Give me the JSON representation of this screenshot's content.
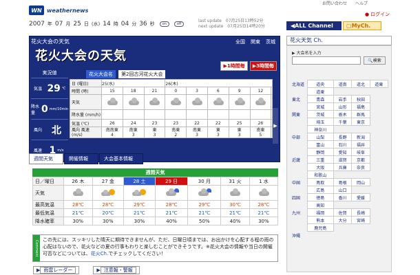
{
  "header": {
    "brand": "weathernews",
    "links": [
      "お問い合わせ",
      "ヘルプ"
    ],
    "login": "ログイン"
  },
  "datebar": {
    "year": "2007",
    "month": "07",
    "day": "25",
    "weekday": "水",
    "hour": "14",
    "minute": "04",
    "second": "36",
    "toggles": [
      "on",
      "off"
    ],
    "last_update_label": "last update",
    "last_update_value": "07月25日13時52分",
    "next_update_label": "next update",
    "next_update_value": "07月25日14時20分"
  },
  "main": {
    "panel_title": "花火大会の天気",
    "region_tabs": [
      "全国",
      "関東",
      "茨城"
    ],
    "big_title": "花火大会の天気",
    "radar_buttons": [
      "1時間毎",
      "3時間毎"
    ],
    "current": {
      "heading": "実況値",
      "rows": [
        {
          "label": "気温",
          "value": "29",
          "unit": "℃"
        },
        {
          "label": "降水量",
          "value": "0",
          "unit": "mm/10min"
        },
        {
          "label": "風向",
          "value": "北",
          "unit": ""
        },
        {
          "label": "風速",
          "value": "1",
          "unit": "m/s"
        }
      ]
    },
    "event_tag": "花火大会名",
    "event_name": "第2回古河花火大会",
    "hourly": {
      "day_label": "日 (曜日)",
      "days": [
        {
          "label": "25(水)",
          "span": 3
        },
        {
          "label": "26(木)",
          "span": 6
        }
      ],
      "time_label": "時間 (時)",
      "times": [
        "15",
        "18",
        "21",
        "0",
        "3",
        "6",
        "9",
        "12",
        ""
      ],
      "weather_label": "天気",
      "precip_label": "降水量 (mm/h)",
      "temp_label": "気温 (℃)",
      "temps": [
        "26",
        "24",
        "23",
        "23",
        "22",
        "22",
        "25",
        "26",
        ""
      ],
      "wind_label": "風向 風速 (m/s)",
      "winds": [
        {
          "dir": "南南東",
          "speed": "4"
        },
        {
          "dir": "南東",
          "speed": "3"
        },
        {
          "dir": "東",
          "speed": "3"
        },
        {
          "dir": "南東",
          "speed": "2"
        },
        {
          "dir": "南東",
          "speed": "3"
        },
        {
          "dir": "東",
          "speed": "3"
        },
        {
          "dir": "東",
          "speed": "3"
        },
        {
          "dir": "南東",
          "speed": "5"
        },
        {
          "dir": "",
          "speed": ""
        }
      ]
    },
    "scroll_arrow": "▶"
  },
  "tabs": [
    "週間天気",
    "開催情報",
    "大会基本情報"
  ],
  "weekly": {
    "heading": "週間天気",
    "day_label": "日／曜日",
    "days": [
      {
        "label": "26 木",
        "kind": "normal"
      },
      {
        "label": "27 金",
        "kind": "normal"
      },
      {
        "label": "28 土",
        "kind": "sat"
      },
      {
        "label": "29 日",
        "kind": "sun"
      },
      {
        "label": "30 月",
        "kind": "normal"
      },
      {
        "label": "31 火",
        "kind": "normal"
      },
      {
        "label": "1 水",
        "kind": "normal"
      }
    ],
    "icons": [
      "cloud",
      "sun-cloud",
      "sun-cloud",
      "cloud-rain",
      "cloud-rain",
      "cloud",
      "cloud"
    ],
    "weather_label": "天気",
    "high_label": "最高気温",
    "highs": [
      "28℃",
      "28℃",
      "29℃",
      "28℃",
      "29℃",
      "30℃",
      "28℃"
    ],
    "low_label": "最低気温",
    "lows": [
      "21℃",
      "20℃",
      "21℃",
      "21℃",
      "21℃",
      "21℃",
      "21℃"
    ],
    "pop_label": "降水確率",
    "pops": [
      "30%",
      "30%",
      "30%",
      "40%",
      "50%",
      "40%",
      "30%"
    ]
  },
  "comment": {
    "side_label": "Comment",
    "text": "この先には、スッキリした晴天に期待できませんが、ただ、日曜日頃までは、お出かけを心配する程の雨の心配はないので、花火などの夏の行事もわりと楽しむことができそうです。※花火大会の情報や当日の開催可否などについては、",
    "link": "花火Ch.",
    "tail": "でチェックしてください！"
  },
  "bottom_links": [
    "雨雲レーダー",
    "注意報・警報"
  ],
  "right": {
    "all_channel": "ALL Channel",
    "mych": "MyCh.",
    "channel_title": "花火天気 Ch.",
    "search_label": "大会名を入力",
    "search_button": "検索",
    "regions": [
      {
        "name": "北海道",
        "prefs": [
          "道央",
          "道南",
          "道北",
          "道東"
        ]
      },
      {
        "name": "",
        "prefs": [
          "道東",
          "",
          "",
          ""
        ]
      },
      {
        "name": "東北",
        "prefs": [
          "青森",
          "岩手",
          "秋田",
          ""
        ]
      },
      {
        "name": "",
        "prefs": [
          "宮城",
          "山形",
          "福島",
          ""
        ]
      },
      {
        "name": "関東",
        "prefs": [
          "茨城",
          "栃木",
          "群馬",
          ""
        ]
      },
      {
        "name": "",
        "prefs": [
          "埼玉",
          "千葉",
          "東京",
          ""
        ]
      },
      {
        "name": "",
        "prefs": [
          "神奈川",
          "",
          "",
          ""
        ]
      },
      {
        "name": "中部",
        "prefs": [
          "山梨",
          "長野",
          "新潟",
          ""
        ]
      },
      {
        "name": "",
        "prefs": [
          "富山",
          "石川",
          "福井",
          ""
        ]
      },
      {
        "name": "",
        "prefs": [
          "静岡",
          "愛知",
          "岐阜",
          ""
        ]
      },
      {
        "name": "近畿",
        "prefs": [
          "三重",
          "滋賀",
          "京都",
          ""
        ]
      },
      {
        "name": "",
        "prefs": [
          "大阪",
          "兵庫",
          "奈良",
          ""
        ]
      },
      {
        "name": "",
        "prefs": [
          "和歌山",
          "",
          "",
          ""
        ]
      },
      {
        "name": "中国",
        "prefs": [
          "鳥取",
          "島根",
          "岡山",
          ""
        ]
      },
      {
        "name": "",
        "prefs": [
          "広島",
          "山口",
          "",
          ""
        ]
      },
      {
        "name": "四国",
        "prefs": [
          "徳島",
          "香川",
          "愛媛",
          ""
        ]
      },
      {
        "name": "",
        "prefs": [
          "高知",
          "",
          "",
          ""
        ]
      },
      {
        "name": "九州",
        "prefs": [
          "福岡",
          "佐賀",
          "長崎",
          ""
        ]
      },
      {
        "name": "",
        "prefs": [
          "熊本",
          "大分",
          "宮崎",
          ""
        ]
      },
      {
        "name": "",
        "prefs": [
          "鹿児島",
          "",
          "",
          ""
        ]
      },
      {
        "name": "沖縄",
        "prefs": [
          "",
          "",
          "",
          ""
        ]
      }
    ]
  }
}
